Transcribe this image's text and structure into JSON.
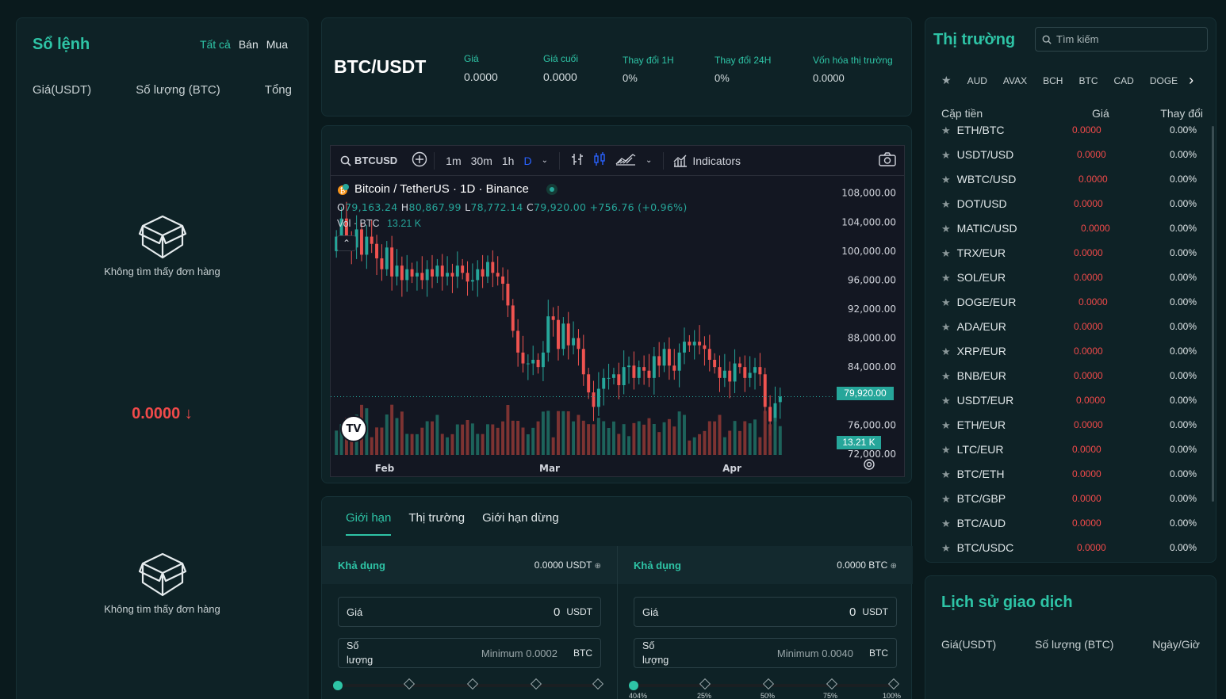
{
  "orderbook": {
    "title": "Sổ lệnh",
    "filters": [
      "Tất cả",
      "Bán",
      "Mua"
    ],
    "columns": [
      "Giá(USDT)",
      "Số lượng (BTC)",
      "Tổng"
    ],
    "empty_text": "Không tìm thấy đơn hàng",
    "last_price": "0.0000",
    "last_price_arrow": "↓"
  },
  "ticker": {
    "pair": "BTC/USDT",
    "stats": [
      {
        "label": "Giá",
        "value": "0.0000"
      },
      {
        "label": "Giá cuối",
        "value": "0.0000"
      },
      {
        "label": "Thay đổi 1H",
        "value": "0%"
      },
      {
        "label": "Thay đổi 24H",
        "value": "0%"
      },
      {
        "label": "Vốn hóa thị trường",
        "value": "0.0000"
      }
    ]
  },
  "chart": {
    "symbol": "BTCUSD",
    "intervals": [
      "1m",
      "30m",
      "1h",
      "D"
    ],
    "indicators_label": "Indicators",
    "legend_title": "Bitcoin / TetherUS · 1D · Binance",
    "ohlc": {
      "o_label": "O",
      "o": "79,163.24",
      "h_label": "H",
      "h": "80,867.99",
      "l_label": "L",
      "l": "78,772.14",
      "c_label": "C",
      "c": "79,920.00",
      "change": "+756.76 (+0.96%)"
    },
    "vol_label": "Vol · BTC",
    "vol_value": "13.21 K",
    "price_badge": "79,920.00",
    "vol_badge": "13.21 K",
    "colors": {
      "up": "#26a69a",
      "down": "#ef5350",
      "bg": "#131722"
    }
  },
  "chart_data": {
    "type": "candlestick",
    "title": "Bitcoin / TetherUS · 1D · Binance",
    "x_ticks": [
      "Feb",
      "Mar",
      "Apr"
    ],
    "y_ticks": [
      "108,000.00",
      "104,000.00",
      "100,000.00",
      "96,000.00",
      "92,000.00",
      "88,000.00",
      "84,000.00",
      "76,000.00",
      "72,000.00"
    ],
    "ylim": [
      71000,
      109500
    ],
    "last_price": 79920,
    "closes": [
      102000,
      104500,
      101500,
      100500,
      103000,
      99500,
      102000,
      101000,
      99000,
      97500,
      100500,
      96500,
      98000,
      96000,
      97500,
      96500,
      97000,
      96000,
      97500,
      96500,
      98000,
      96500,
      97000,
      96500,
      98000,
      97000,
      95800,
      96000,
      97500,
      96500,
      98500,
      97000,
      96500,
      95500,
      92500,
      89000,
      86000,
      84500,
      84500,
      85000,
      84000,
      86000,
      91000,
      90500,
      86500,
      90000,
      87000,
      88000,
      86500,
      83000,
      80500,
      78500,
      81000,
      82500,
      82500,
      83000,
      81500,
      84000,
      84200,
      82500,
      84000,
      83500,
      82500,
      85500,
      84200,
      86500,
      84200,
      83500,
      86000,
      87500,
      87000,
      87500,
      87000,
      86500,
      85000,
      84000,
      82500,
      83500,
      82000,
      84500,
      84000,
      82500,
      83200,
      84000,
      83000,
      78500,
      76500,
      79000,
      79920
    ],
    "opens": [
      100000,
      102000,
      104500,
      101500,
      100500,
      103000,
      99500,
      102000,
      101000,
      99000,
      97500,
      100500,
      96500,
      98000,
      96000,
      97500,
      96500,
      97000,
      96000,
      97500,
      96500,
      98000,
      96500,
      97000,
      96500,
      98000,
      97000,
      95800,
      96000,
      97500,
      96500,
      98500,
      97000,
      96500,
      95500,
      92500,
      89000,
      86000,
      84500,
      84500,
      85000,
      84000,
      86000,
      91000,
      90500,
      86500,
      90000,
      87000,
      88000,
      86500,
      83000,
      80500,
      78500,
      81000,
      82500,
      82500,
      83000,
      81500,
      84000,
      84200,
      82500,
      84000,
      83500,
      82500,
      85500,
      84200,
      86500,
      84200,
      83500,
      86000,
      87500,
      87000,
      87500,
      87000,
      86500,
      85000,
      84000,
      82500,
      83500,
      82000,
      84500,
      84000,
      82500,
      83200,
      84000,
      83000,
      78500,
      76500,
      79163
    ]
  },
  "form": {
    "tabs": [
      "Giới hạn",
      "Thị trường",
      "Giới hạn dừng"
    ],
    "buy": {
      "avail_label": "Khả dụng",
      "avail_value": "0.0000 USDT",
      "price_label": "Giá",
      "price_value": "0",
      "price_unit": "USDT",
      "qty_label": "Số lượng",
      "qty_placeholder": "Minimum 0.0002",
      "qty_unit": "BTC"
    },
    "sell": {
      "avail_label": "Khả dụng",
      "avail_value": "0.0000 BTC",
      "price_label": "Giá",
      "price_value": "0",
      "price_unit": "USDT",
      "qty_label": "Số lượng",
      "qty_placeholder": "Minimum 0.0040",
      "qty_unit": "BTC",
      "slider_marks": [
        "404%",
        "25%",
        "50%",
        "75%",
        "100%"
      ]
    }
  },
  "market": {
    "title": "Thị trường",
    "search_placeholder": "Tìm kiếm",
    "currencies": [
      "AUD",
      "AVAX",
      "BCH",
      "BTC",
      "CAD",
      "DOGE"
    ],
    "columns": [
      "Cặp tiền",
      "Giá",
      "Thay đổi"
    ],
    "rows": [
      {
        "pair": "ETH/BTC",
        "price": "0.0000",
        "change": "0.00%"
      },
      {
        "pair": "USDT/USD",
        "price": "0.0000",
        "change": "0.00%"
      },
      {
        "pair": "WBTC/USD",
        "price": "0.0000",
        "change": "0.00%"
      },
      {
        "pair": "DOT/USD",
        "price": "0.0000",
        "change": "0.00%"
      },
      {
        "pair": "MATIC/USD",
        "price": "0.0000",
        "change": "0.00%"
      },
      {
        "pair": "TRX/EUR",
        "price": "0.0000",
        "change": "0.00%"
      },
      {
        "pair": "SOL/EUR",
        "price": "0.0000",
        "change": "0.00%"
      },
      {
        "pair": "DOGE/EUR",
        "price": "0.0000",
        "change": "0.00%"
      },
      {
        "pair": "ADA/EUR",
        "price": "0.0000",
        "change": "0.00%"
      },
      {
        "pair": "XRP/EUR",
        "price": "0.0000",
        "change": "0.00%"
      },
      {
        "pair": "BNB/EUR",
        "price": "0.0000",
        "change": "0.00%"
      },
      {
        "pair": "USDT/EUR",
        "price": "0.0000",
        "change": "0.00%"
      },
      {
        "pair": "ETH/EUR",
        "price": "0.0000",
        "change": "0.00%"
      },
      {
        "pair": "LTC/EUR",
        "price": "0.0000",
        "change": "0.00%"
      },
      {
        "pair": "BTC/ETH",
        "price": "0.0000",
        "change": "0.00%"
      },
      {
        "pair": "BTC/GBP",
        "price": "0.0000",
        "change": "0.00%"
      },
      {
        "pair": "BTC/AUD",
        "price": "0.0000",
        "change": "0.00%"
      },
      {
        "pair": "BTC/USDC",
        "price": "0.0000",
        "change": "0.00%"
      }
    ]
  },
  "history": {
    "title": "Lịch sử giao dịch",
    "columns": [
      "Giá(USDT)",
      "Số lượng (BTC)",
      "Ngày/Giờ"
    ]
  }
}
